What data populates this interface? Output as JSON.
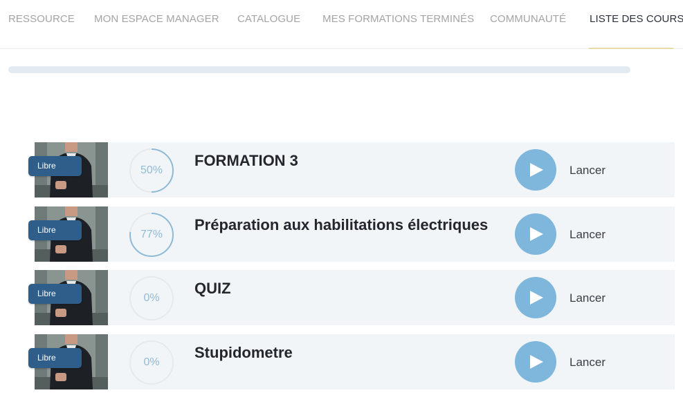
{
  "nav": {
    "items": [
      {
        "label": "RESSOURCE",
        "active": false
      },
      {
        "label": "MON ESPACE MANAGER",
        "active": false
      },
      {
        "label": "CATALOGUE",
        "active": false
      },
      {
        "label": "MES FORMATIONS TERMINÉS",
        "active": false
      },
      {
        "label": "COMMUNAUTÉ",
        "active": false
      },
      {
        "label": "LISTE DES COURS",
        "active": true
      }
    ]
  },
  "courses": [
    {
      "title": "FORMATION 3",
      "badge": "Libre",
      "progress_label": "50%",
      "progress": 0.5,
      "action_label": "Lancer"
    },
    {
      "title": "Préparation aux habilitations électriques",
      "badge": "Libre",
      "progress_label": "77%",
      "progress": 0.77,
      "action_label": "Lancer"
    },
    {
      "title": "QUIZ",
      "badge": "Libre",
      "progress_label": "0%",
      "progress": 0,
      "action_label": "Lancer"
    },
    {
      "title": "Stupidometre",
      "badge": "Libre",
      "progress_label": "0%",
      "progress": 0,
      "action_label": "Lancer"
    }
  ],
  "colors": {
    "accent": "#7fb7dc",
    "badge": "#2f5e8a",
    "row_background": "#f2f5f8",
    "ring_track": "#e4eaee",
    "active_underline": "#e8d9a8"
  },
  "icons": {
    "play": "play-icon"
  }
}
